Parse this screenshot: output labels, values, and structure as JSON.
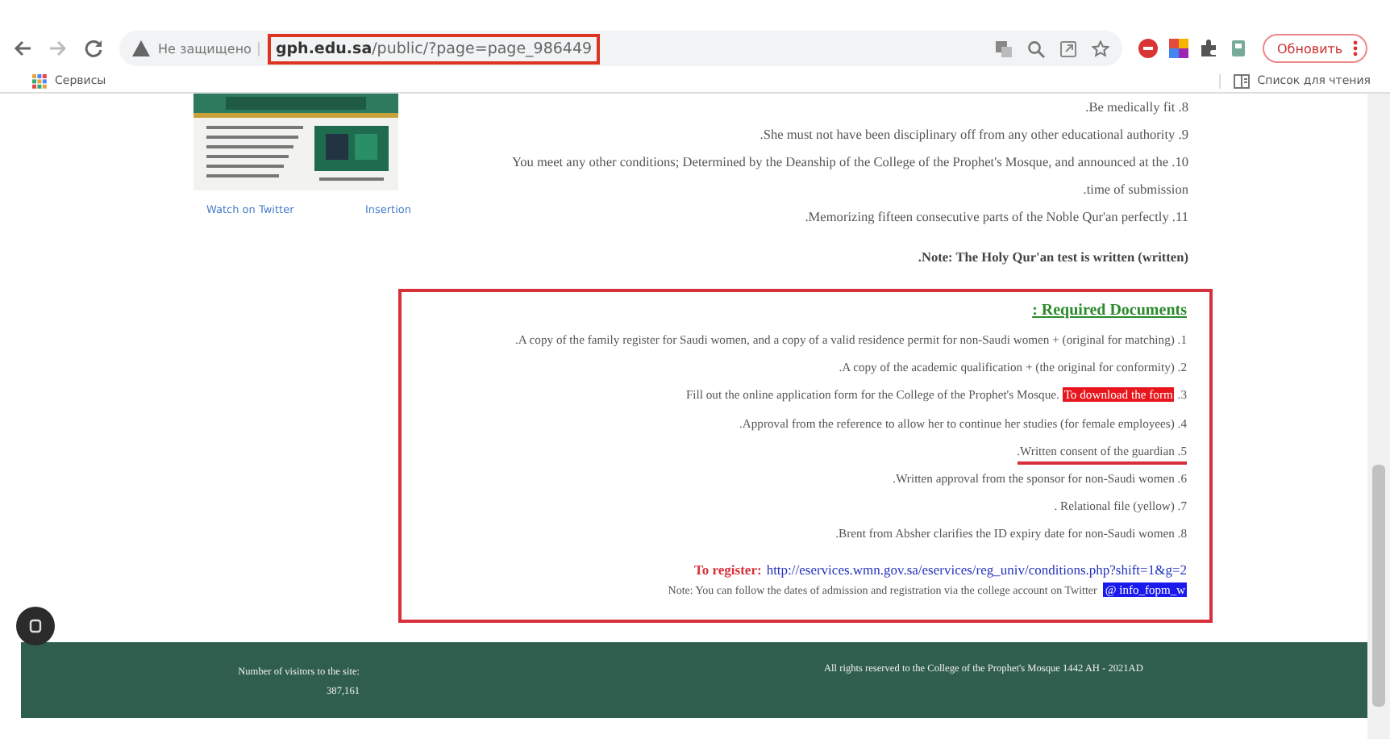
{
  "browser": {
    "not_secure": "Не защищено",
    "url_host": "gph.edu.sa",
    "url_path": "/public/?page=page_986449",
    "url_highlighted": true,
    "update_button": "Обновить",
    "bookmarks": [
      "Сервисы"
    ],
    "reading_list": "Список для чтения"
  },
  "sidebar": {
    "links": [
      "Watch on Twitter",
      "Insertion"
    ]
  },
  "conditions": [
    ".Be medically fit .8",
    ".She must not have been disciplinary off from any other educational authority .9",
    "You meet any other conditions; Determined by the Deanship of the College of the Prophet's Mosque, and announced at the .10",
    ".time of submission",
    ".Memorizing fifteen consecutive parts of the Noble Qur'an perfectly .11"
  ],
  "note": ".Note: The Holy Qur'an test is written (written)",
  "required": {
    "highlighted": true,
    "title": ": Required Documents",
    "items": [
      {
        "text": ".A copy of the family register for Saudi women, and a copy of a valid residence permit for non-Saudi women + (original for matching) .1",
        "underlined": false
      },
      {
        "text": ".A copy of the academic qualification + (the original for conformity) .2",
        "underlined": false
      },
      {
        "text": "Fill out the online application form for the College of the Prophet's Mosque.",
        "link": "To download the form",
        "number": ".3",
        "underlined": false
      },
      {
        "text": ".Approval from the reference to allow her to continue her studies (for female employees) .4",
        "underlined": false
      },
      {
        "text": ".Written consent of the guardian .5",
        "underlined": true
      },
      {
        "text": ".Written approval from the sponsor for non-Saudi women .6",
        "underlined": false
      },
      {
        "text": ". Relational file (yellow) .7",
        "underlined": false
      },
      {
        "text": ".Brent from Absher clarifies the ID expiry date for non-Saudi women .8",
        "underlined": false
      }
    ],
    "register_label": "To register:",
    "register_url": "http://eservices.wmn.gov.sa/eservices/reg_univ/conditions.php?shift=1&g=2",
    "twitter_note": "Note: You can follow the dates of admission and registration via the college account on Twitter",
    "twitter_handle": "@ info_fopm_w"
  },
  "footer": {
    "visitors_label": "Number of visitors to the site:",
    "visitors_count": "387,161",
    "copyright": "All rights reserved to the College of the Prophet's Mosque 1442 AH - 2021AD"
  }
}
